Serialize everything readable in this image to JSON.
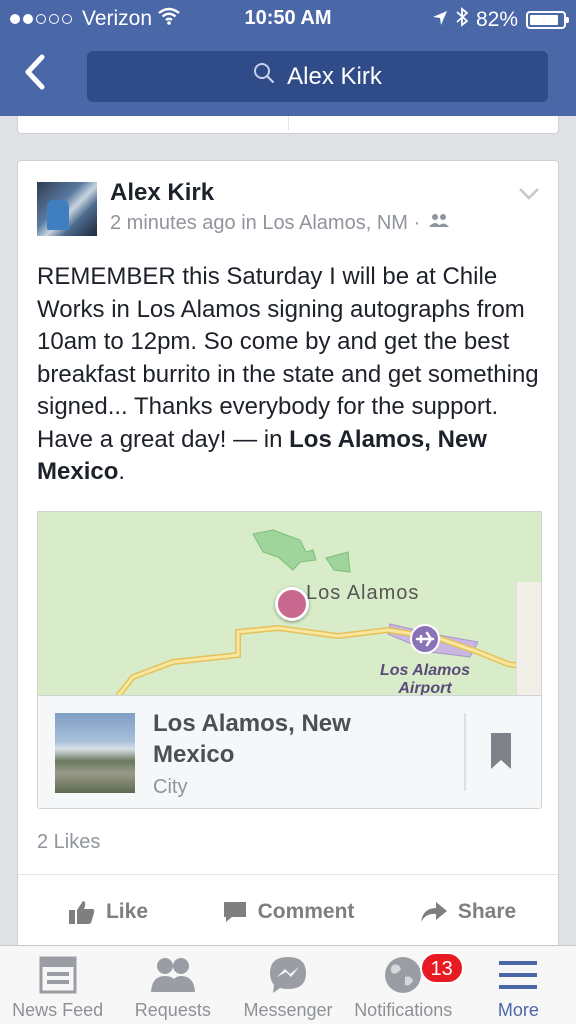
{
  "status_bar": {
    "carrier": "Verizon",
    "time": "10:50 AM",
    "battery": "82%"
  },
  "nav": {
    "search_text": "Alex Kirk"
  },
  "post": {
    "author": "Alex Kirk",
    "meta": "2 minutes ago in Los Alamos, NM ·",
    "text_body": "REMEMBER this Saturday I will be at Chile Works in Los Alamos signing autographs from 10am to 12pm. So come by and get the best breakfast burrito in the state and get something signed... Thanks everybody for the support. Have a great day! — in ",
    "text_place": "Los Alamos, New Mexico",
    "text_end": ".",
    "map": {
      "town_label": "Los Alamos",
      "airport_label": "Los Alamos Airport"
    },
    "place": {
      "title": "Los Alamos, New Mexico",
      "subtitle": "City"
    },
    "likes": "2 Likes",
    "actions": {
      "like": "Like",
      "comment": "Comment",
      "share": "Share"
    }
  },
  "tabbar": {
    "items": [
      {
        "label": "News Feed",
        "icon": "news-feed-icon"
      },
      {
        "label": "Requests",
        "icon": "friend-requests-icon"
      },
      {
        "label": "Messenger",
        "icon": "messenger-icon"
      },
      {
        "label": "Notifications",
        "icon": "globe-icon",
        "badge": "13"
      },
      {
        "label": "More",
        "icon": "menu-icon"
      }
    ]
  },
  "colors": {
    "header": "#4a67a8",
    "search_field": "#2f4b88",
    "badge": "#e81b24",
    "pin": "#c9688e"
  }
}
